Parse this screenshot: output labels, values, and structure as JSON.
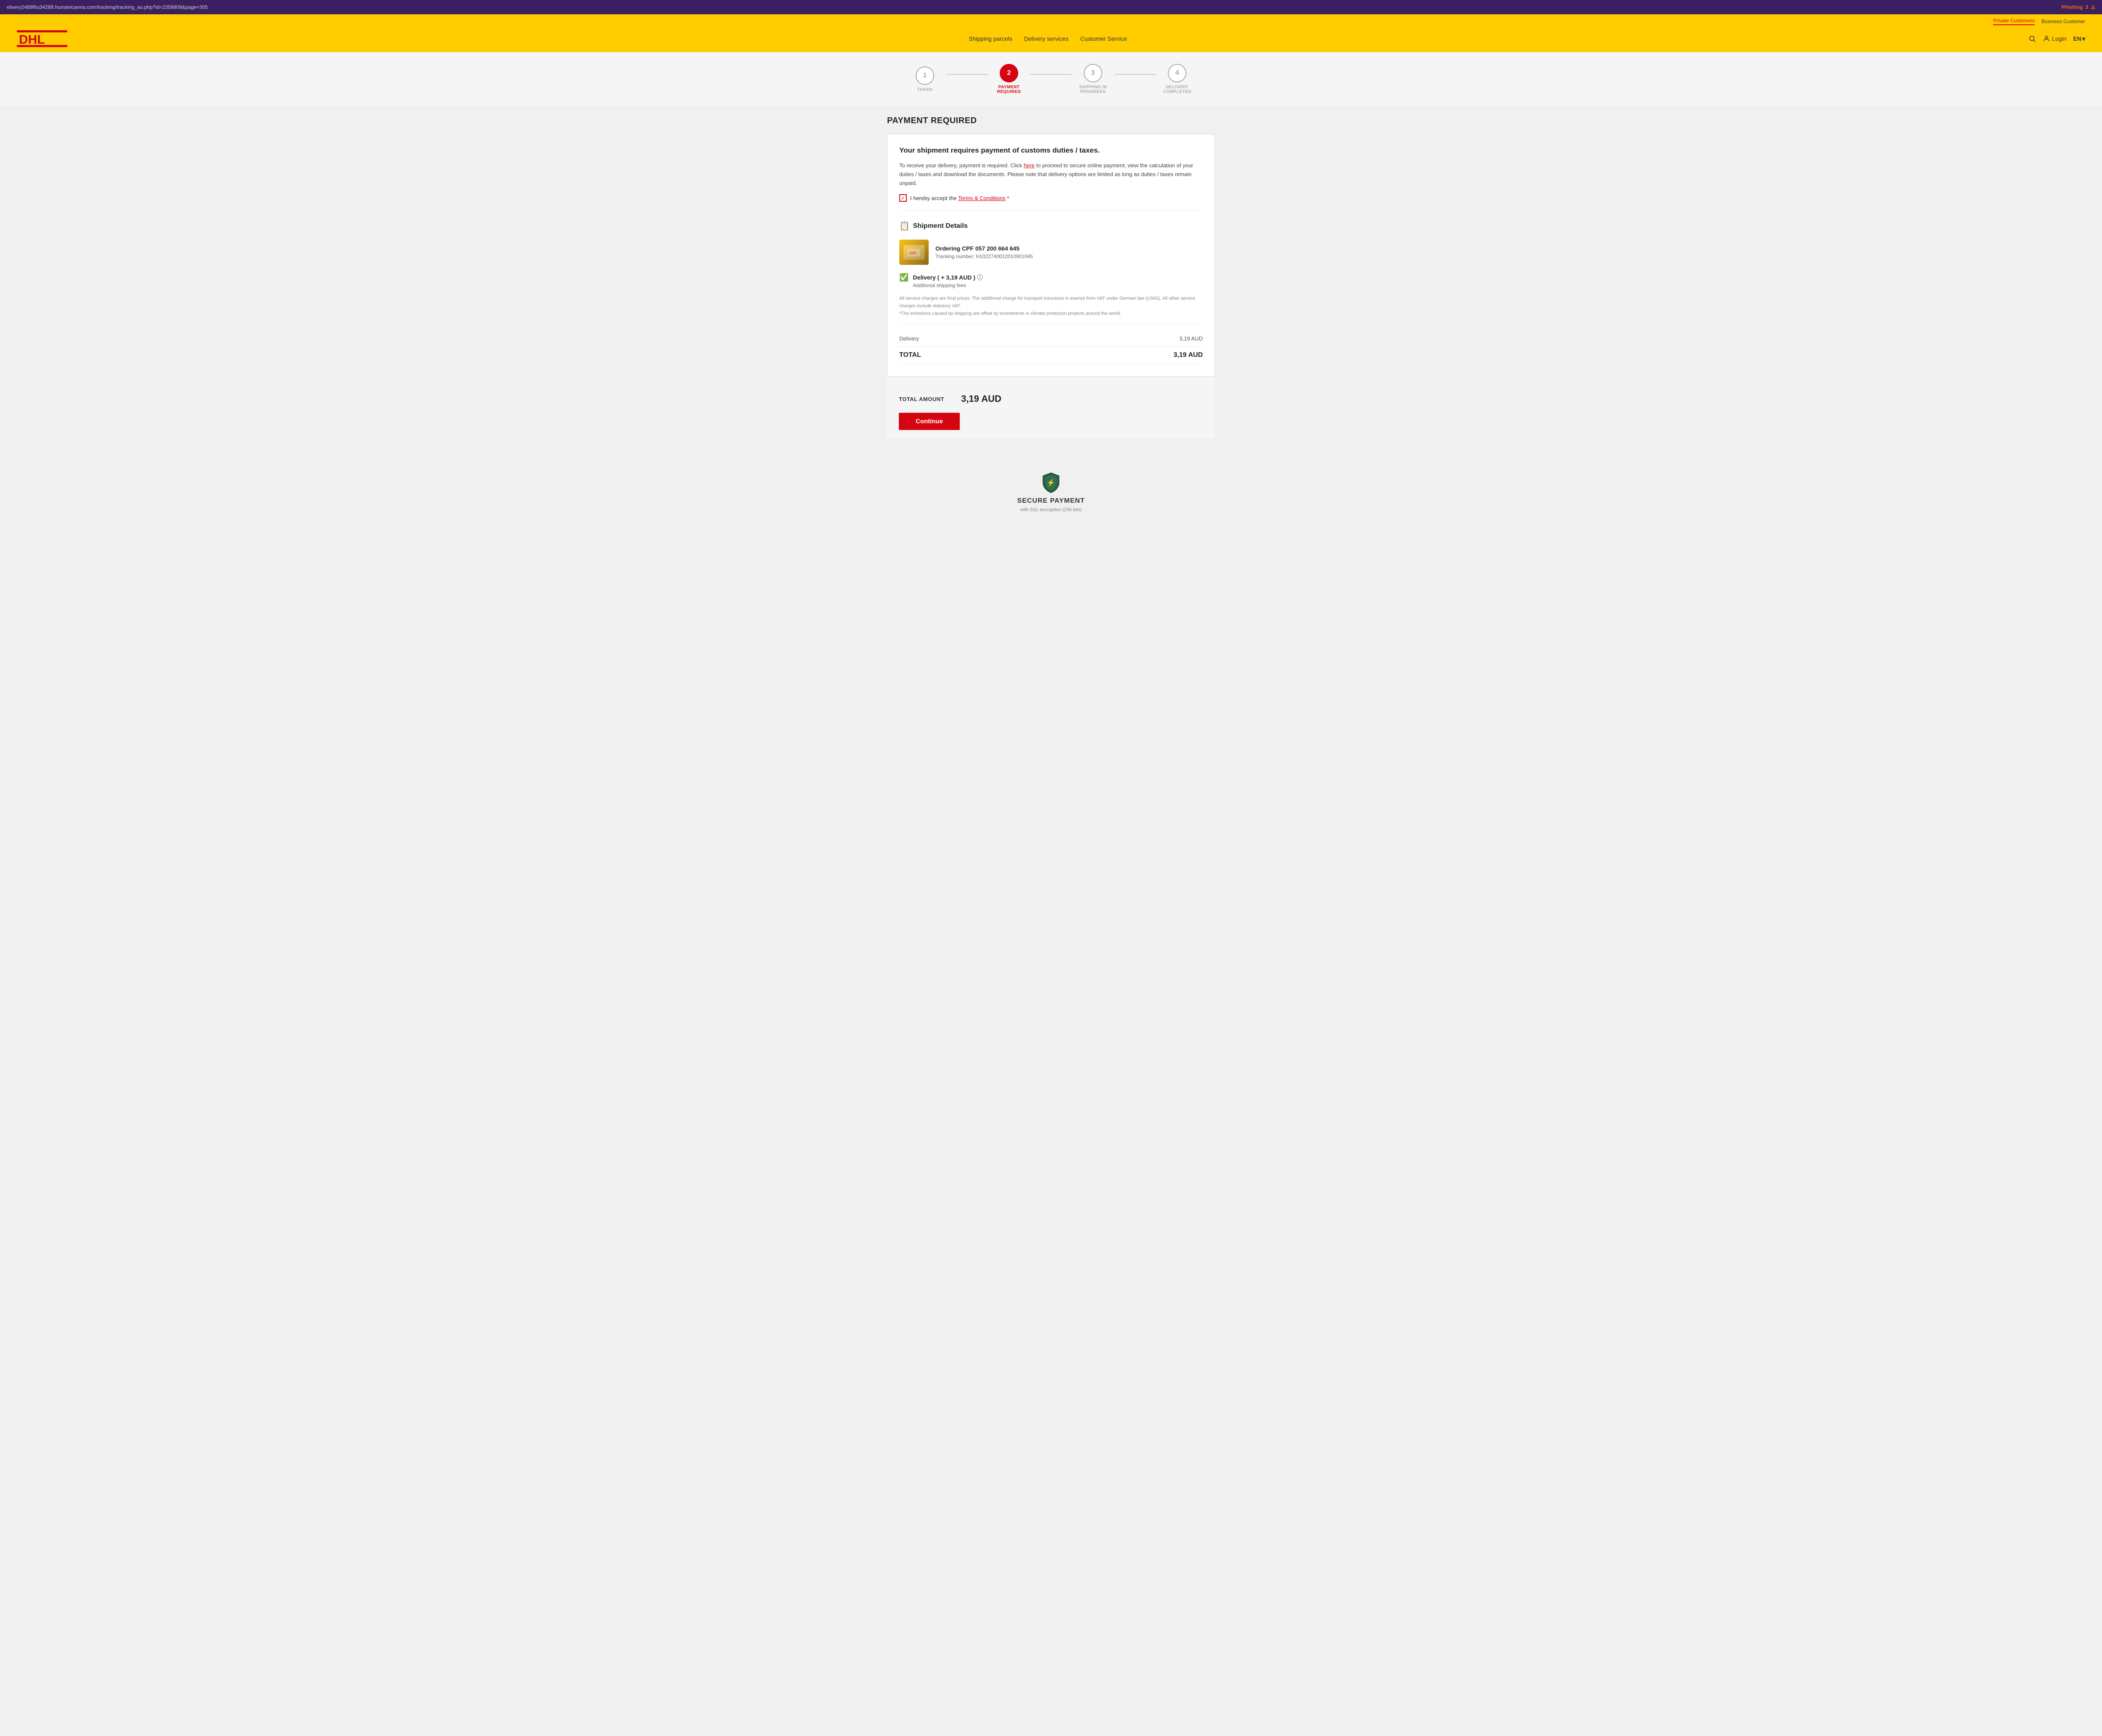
{
  "browser": {
    "url": "elivery2489fhu34289.humanicanna.com/tracking/tracking_au.php?id=2359809&page=305",
    "phishing_label": "Phishing",
    "phishing_count": "3"
  },
  "header": {
    "logo_text": "DHL",
    "nav_private": "Private Customers",
    "nav_business": "Business Customer",
    "nav_links": [
      {
        "label": "Shipping parcels"
      },
      {
        "label": "Delivery services"
      },
      {
        "label": "Customer Service"
      }
    ],
    "login_label": "Login",
    "lang_label": "EN"
  },
  "steps": [
    {
      "number": "1",
      "label": "TAKED",
      "active": false
    },
    {
      "number": "2",
      "label": "PAYMENT REQUIRED",
      "active": true
    },
    {
      "number": "3",
      "label": "SHIPPING IN PROGRESS",
      "active": false
    },
    {
      "number": "4",
      "label": "DELIVERY COMPLETED",
      "active": false
    }
  ],
  "page": {
    "title": "PAYMENT REQUIRED",
    "card_heading": "Your shipment requires payment of customs duties / taxes.",
    "card_desc_1": "To receive your delivery, payment is required. Click ",
    "card_desc_link": "here",
    "card_desc_2": " to proceed to secure online payment, view the calculation of your duties / taxes and download the documents. Please note that delivery options are limited as long as duties / taxes remain unpaid.",
    "checkbox_label_1": "I hereby accept the ",
    "checkbox_terms": "Terms & Conditions",
    "checkbox_label_2": " *",
    "shipment_section_title": "Shipment Details",
    "order_label": "Ordering CPF 057 200 664 645",
    "tracking_label": "Tracking number: H1022740012010901045",
    "delivery_title": "Delivery ( + 3,19 AUD )",
    "delivery_sub": "Additional shipping fees",
    "fine_print_1": "All service charges are final prices. The additional charge for transport insurance is exempt from VAT under German law (UStG). All other service charges include statutory VAT.",
    "fine_print_2": "*The emissions caused by shipping are offset by investments in climate protection projects around the world.",
    "delivery_row_label": "Delivery",
    "delivery_row_value": "3,19 AUD",
    "total_label": "TOTAL",
    "total_value": "3,19 AUD",
    "total_amount_label": "TOTAL AMOUNT",
    "total_amount_value": "3,19 AUD",
    "continue_button": "Continue",
    "secure_title": "SECURE PAYMENT",
    "secure_sub": "with SSL encryption (256 bits)"
  }
}
